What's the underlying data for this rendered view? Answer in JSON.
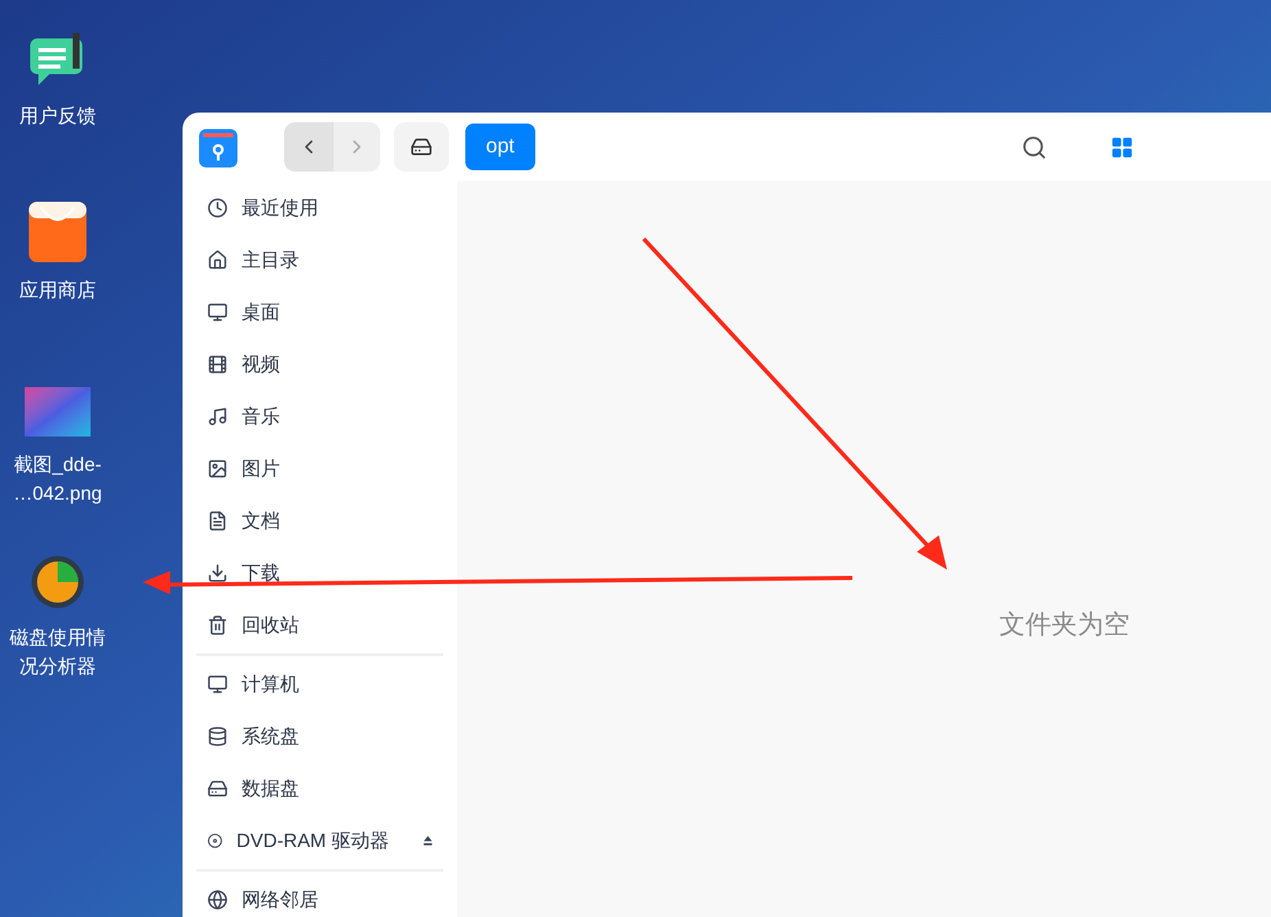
{
  "desktop_icons": [
    {
      "label": "用户反馈"
    },
    {
      "label": "应用商店"
    },
    {
      "label": "截图_dde-\n…042.png"
    },
    {
      "label": "磁盘使用情况分析器"
    }
  ],
  "toolbar": {
    "path": "opt"
  },
  "sidebar": {
    "sections": [
      {
        "items": [
          {
            "label": "最近使用",
            "ejectable": false
          },
          {
            "label": "主目录",
            "ejectable": false
          },
          {
            "label": "桌面",
            "ejectable": false
          },
          {
            "label": "视频",
            "ejectable": false
          },
          {
            "label": "音乐",
            "ejectable": false
          },
          {
            "label": "图片",
            "ejectable": false
          },
          {
            "label": "文档",
            "ejectable": false
          },
          {
            "label": "下载",
            "ejectable": false
          },
          {
            "label": "回收站",
            "ejectable": false
          }
        ]
      },
      {
        "items": [
          {
            "label": "计算机",
            "ejectable": false
          },
          {
            "label": "系统盘",
            "ejectable": false
          },
          {
            "label": "数据盘",
            "ejectable": false
          },
          {
            "label": "DVD-RAM 驱动器",
            "ejectable": true
          }
        ]
      },
      {
        "items": [
          {
            "label": "网络邻居",
            "ejectable": false
          }
        ]
      }
    ]
  },
  "empty_message": "文件夹为空"
}
